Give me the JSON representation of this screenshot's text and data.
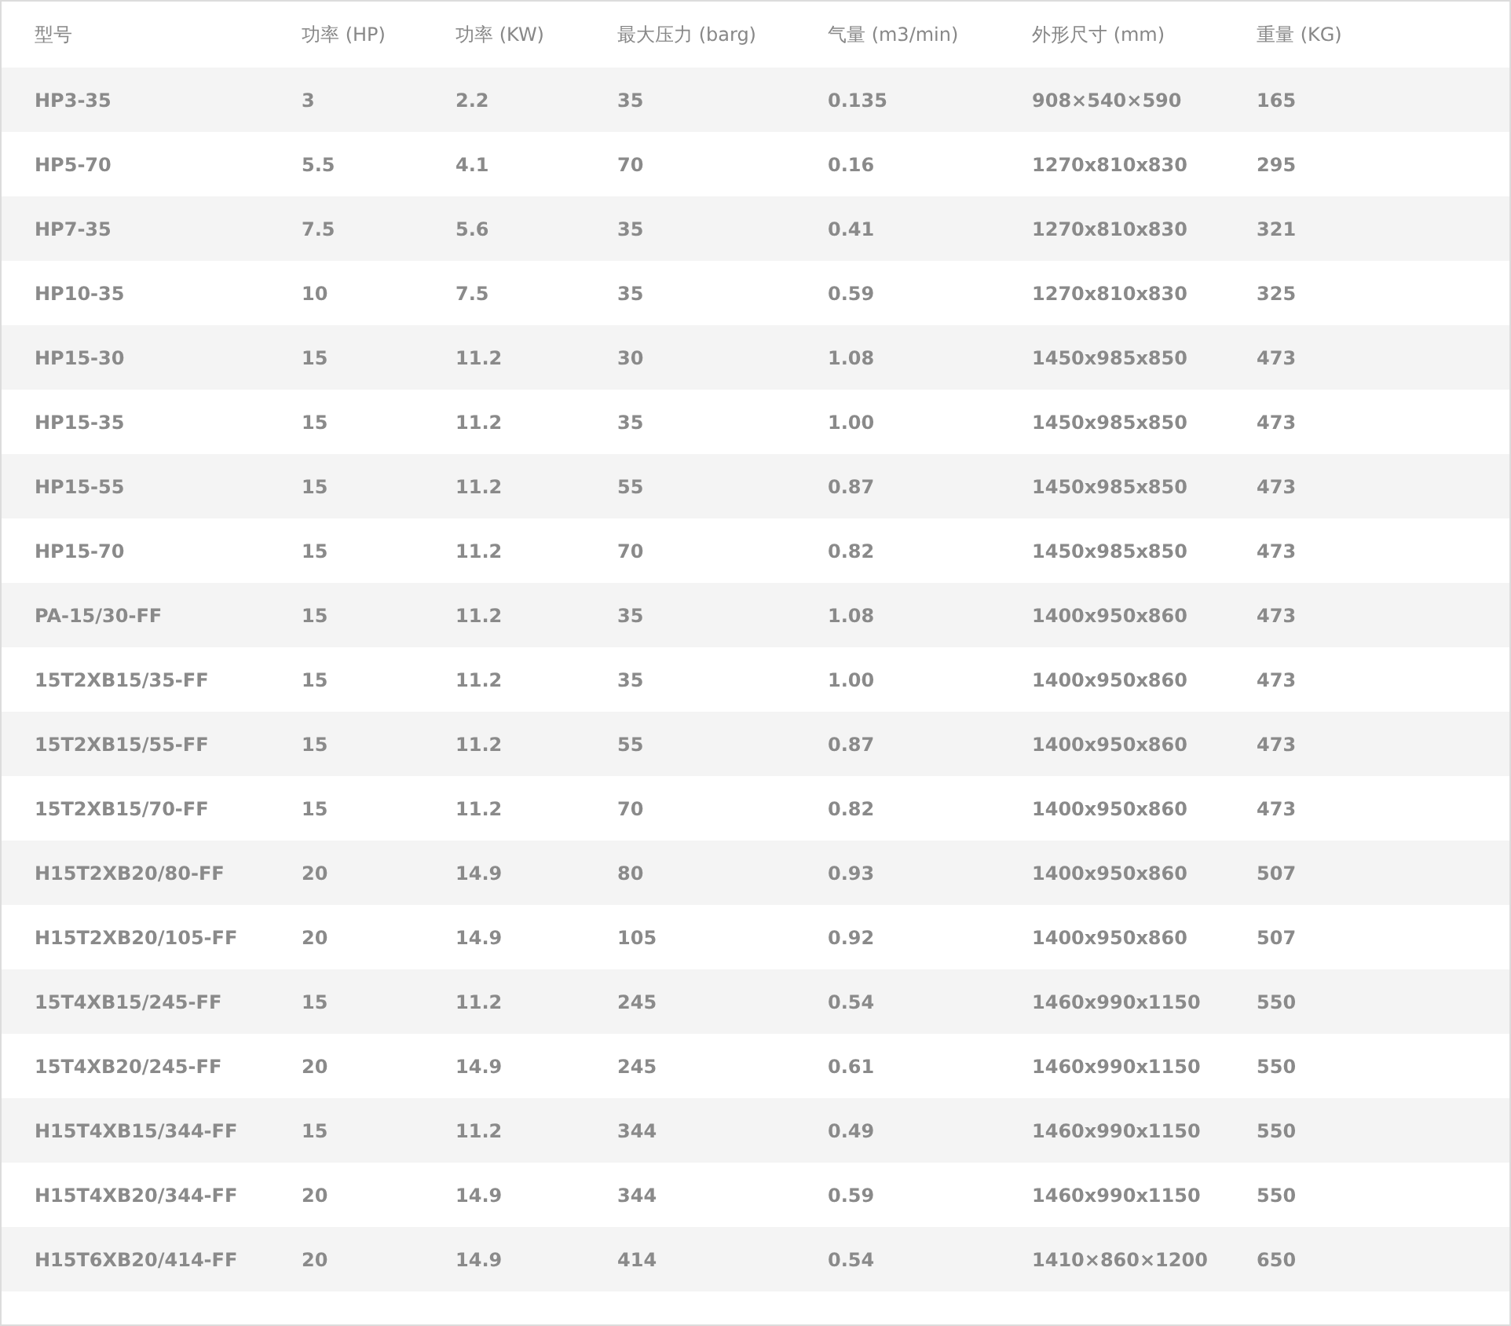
{
  "table": {
    "columns": [
      "型号",
      "功率 (HP)",
      "功率 (KW)",
      "最大压力 (barg)",
      "气量 (m3/min)",
      "外形尺寸 (mm)",
      "重量 (KG)"
    ],
    "rows": [
      [
        "HP3-35",
        "3",
        "2.2",
        "35",
        "0.135",
        "908×540×590",
        "165"
      ],
      [
        "HP5-70",
        "5.5",
        "4.1",
        "70",
        "0.16",
        "1270x810x830",
        "295"
      ],
      [
        "HP7-35",
        "7.5",
        "5.6",
        "35",
        "0.41",
        "1270x810x830",
        "321"
      ],
      [
        "HP10-35",
        "10",
        "7.5",
        "35",
        "0.59",
        "1270x810x830",
        "325"
      ],
      [
        "HP15-30",
        "15",
        "11.2",
        "30",
        "1.08",
        "1450x985x850",
        "473"
      ],
      [
        "HP15-35",
        "15",
        "11.2",
        "35",
        "1.00",
        "1450x985x850",
        "473"
      ],
      [
        "HP15-55",
        "15",
        "11.2",
        "55",
        "0.87",
        "1450x985x850",
        "473"
      ],
      [
        "HP15-70",
        "15",
        "11.2",
        "70",
        "0.82",
        "1450x985x850",
        "473"
      ],
      [
        "PA-15/30-FF",
        "15",
        "11.2",
        "35",
        "1.08",
        "1400x950x860",
        "473"
      ],
      [
        "15T2XB15/35-FF",
        "15",
        "11.2",
        "35",
        "1.00",
        "1400x950x860",
        "473"
      ],
      [
        "15T2XB15/55-FF",
        "15",
        "11.2",
        "55",
        "0.87",
        "1400x950x860",
        "473"
      ],
      [
        "15T2XB15/70-FF",
        "15",
        "11.2",
        "70",
        "0.82",
        "1400x950x860",
        "473"
      ],
      [
        "H15T2XB20/80-FF",
        "20",
        "14.9",
        "80",
        "0.93",
        "1400x950x860",
        "507"
      ],
      [
        "H15T2XB20/105-FF",
        "20",
        "14.9",
        "105",
        "0.92",
        "1400x950x860",
        "507"
      ],
      [
        "15T4XB15/245-FF",
        "15",
        "11.2",
        "245",
        "0.54",
        "1460x990x1150",
        "550"
      ],
      [
        "15T4XB20/245-FF",
        "20",
        "14.9",
        "245",
        "0.61",
        "1460x990x1150",
        "550"
      ],
      [
        "H15T4XB15/344-FF",
        "15",
        "11.2",
        "344",
        "0.49",
        "1460x990x1150",
        "550"
      ],
      [
        "H15T4XB20/344-FF",
        "20",
        "14.9",
        "344",
        "0.59",
        "1460x990x1150",
        "550"
      ],
      [
        "H15T6XB20/414-FF",
        "20",
        "14.9",
        "414",
        "0.54",
        "1410×860×1200",
        "650"
      ]
    ]
  }
}
